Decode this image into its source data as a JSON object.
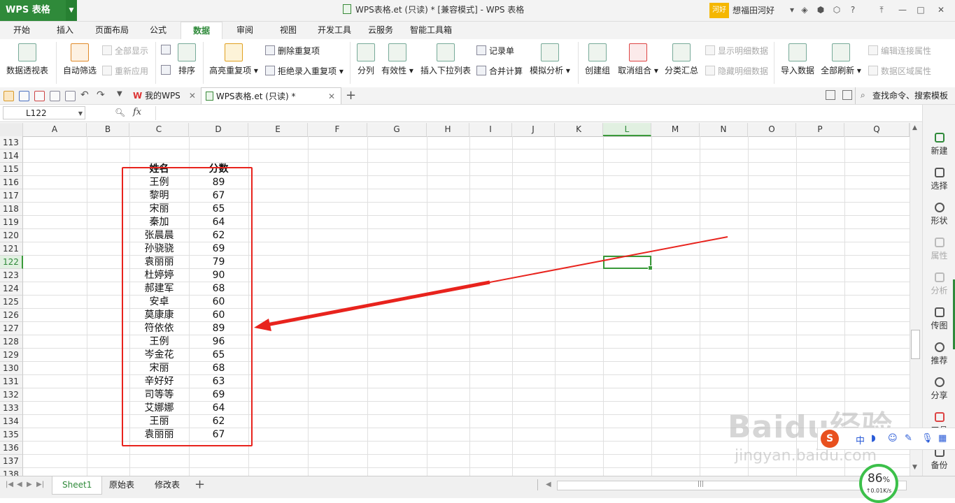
{
  "titlebar": {
    "app_label": "WPS 表格",
    "window_title": "WPS表格.et (只读) * [兼容模式] - WPS 表格",
    "user_badge": "河好",
    "user_name": "想福田河好"
  },
  "menu_tabs": [
    "开始",
    "插入",
    "页面布局",
    "公式",
    "数据",
    "审阅",
    "视图",
    "开发工具",
    "云服务",
    "智能工具箱"
  ],
  "ribbon": {
    "pivot": "数据透视表",
    "autofilter": "自动筛选",
    "show_all": "全部显示",
    "reapply": "重新应用",
    "sort": "排序",
    "highlight_dup": "高亮重复项",
    "remove_dup": "删除重复项",
    "reject_dup": "拒绝录入重复项",
    "split": "分列",
    "validity": "有效性",
    "insert_dropdown": "插入下拉列表",
    "record_form": "记录单",
    "consolidate": "合并计算",
    "simulation": "模拟分析",
    "group": "创建组",
    "ungroup": "取消组合",
    "subtotal": "分类汇总",
    "show_detail": "显示明细数据",
    "hide_detail": "隐藏明细数据",
    "import": "导入数据",
    "refresh_all": "全部刷新",
    "edit_conn": "编辑连接属性",
    "range_props": "数据区域属性"
  },
  "doc_tabs": {
    "my_wps": "我的WPS",
    "current": "WPS表格.et (只读) *",
    "search": "查找命令、搜索模板"
  },
  "formula_bar": {
    "name_box": "L122",
    "fx": "fx"
  },
  "columns": [
    "A",
    "B",
    "C",
    "D",
    "E",
    "F",
    "G",
    "H",
    "I",
    "J",
    "K",
    "L",
    "M",
    "N",
    "O",
    "P",
    "Q"
  ],
  "rows": [
    "113",
    "114",
    "115",
    "116",
    "117",
    "118",
    "119",
    "120",
    "121",
    "122",
    "123",
    "124",
    "125",
    "126",
    "127",
    "128",
    "129",
    "130",
    "131",
    "132",
    "133",
    "134",
    "135",
    "136",
    "137",
    "138"
  ],
  "table": {
    "headers": [
      "姓名",
      "分数"
    ],
    "rows": [
      [
        "王例",
        "89"
      ],
      [
        "黎明",
        "67"
      ],
      [
        "宋丽",
        "65"
      ],
      [
        "秦加",
        "64"
      ],
      [
        "张晨晨",
        "62"
      ],
      [
        "孙骁骁",
        "69"
      ],
      [
        "袁丽丽",
        "79"
      ],
      [
        "杜婷婷",
        "90"
      ],
      [
        "郝建军",
        "68"
      ],
      [
        "安卓",
        "60"
      ],
      [
        "莫康康",
        "60"
      ],
      [
        "符依依",
        "89"
      ],
      [
        "王例",
        "96"
      ],
      [
        "岑金花",
        "65"
      ],
      [
        "宋丽",
        "68"
      ],
      [
        "辛好好",
        "63"
      ],
      [
        "司等等",
        "69"
      ],
      [
        "艾娜娜",
        "64"
      ],
      [
        "王丽",
        "62"
      ],
      [
        "袁丽丽",
        "67"
      ]
    ]
  },
  "sheet_tabs": [
    "Sheet1",
    "原始表",
    "修改表"
  ],
  "right_panel": [
    "新建",
    "选择",
    "形状",
    "属性",
    "分析",
    "传图",
    "推荐",
    "分享",
    "工具",
    "备份"
  ],
  "status": {
    "percent": "86",
    "percent_unit": "%",
    "speed": "↑0.01K/s"
  },
  "ime_logo": "S",
  "watermark": "Baidu经验",
  "watermark_url": "jingyan.baidu.com",
  "colors": {
    "accent_green": "#2f8a3a",
    "highlight_red": "#e8231d"
  }
}
